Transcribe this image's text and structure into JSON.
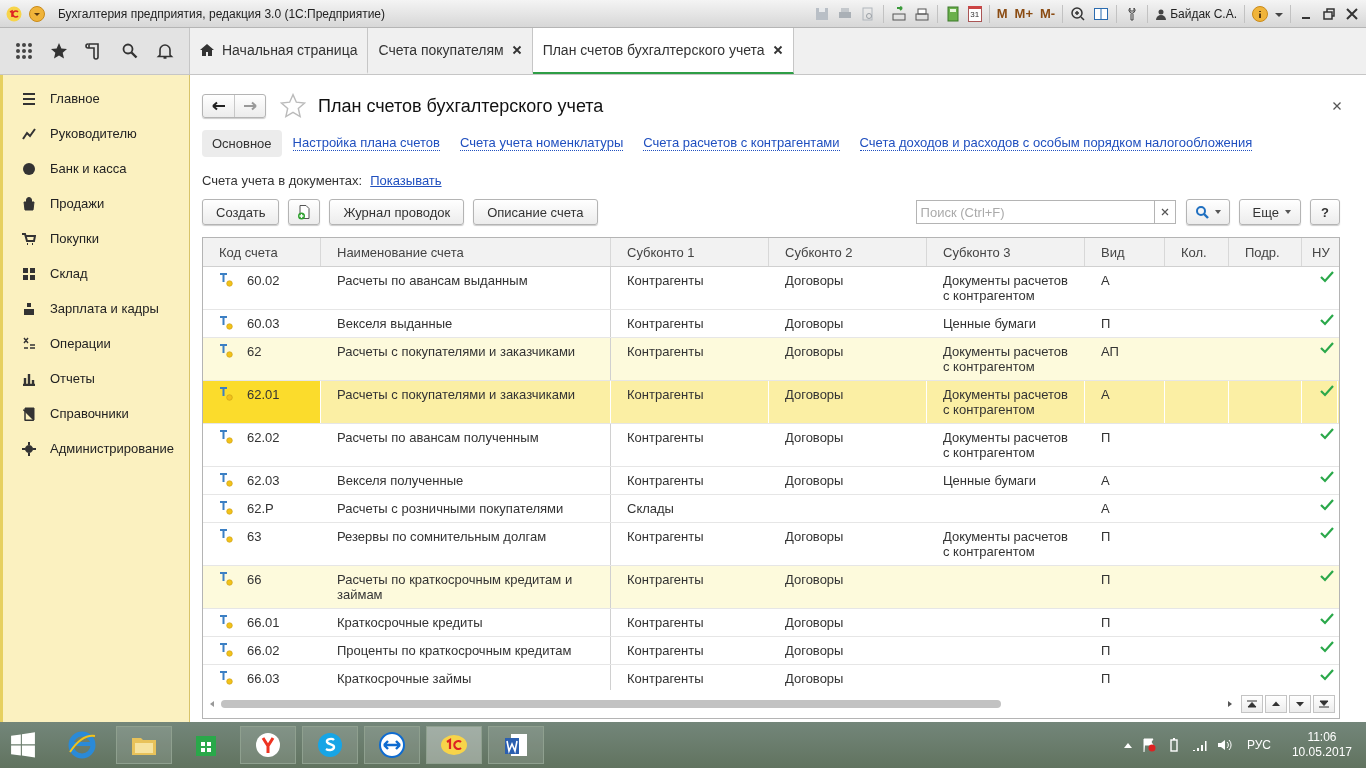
{
  "window": {
    "title": "Бухгалтерия предприятия, редакция 3.0  (1С:Предприятие)",
    "calendar_day": "31",
    "memory_buttons": [
      "M",
      "M+",
      "M-"
    ],
    "user": "Байдак С.А."
  },
  "tabs": [
    {
      "label": "Начальная страница",
      "kind": "home",
      "selected": false
    },
    {
      "label": "Счета покупателям",
      "kind": "closable",
      "selected": false
    },
    {
      "label": "План счетов бухгалтерского учета",
      "kind": "closable",
      "selected": true
    }
  ],
  "sidebar": {
    "items": [
      {
        "label": "Главное"
      },
      {
        "label": "Руководителю"
      },
      {
        "label": "Банк и касса"
      },
      {
        "label": "Продажи"
      },
      {
        "label": "Покупки"
      },
      {
        "label": "Склад"
      },
      {
        "label": "Зарплата и кадры"
      },
      {
        "label": "Операции"
      },
      {
        "label": "Отчеты"
      },
      {
        "label": "Справочники"
      },
      {
        "label": "Администрирование"
      }
    ]
  },
  "page": {
    "title": "План счетов бухгалтерского учета",
    "favorite": false,
    "sections": [
      {
        "label": "Основное",
        "selected": true
      },
      {
        "label": "Настройка плана счетов",
        "selected": false
      },
      {
        "label": "Счета учета номенклатуры",
        "selected": false
      },
      {
        "label": "Счета расчетов с контрагентами",
        "selected": false
      },
      {
        "label": "Счета доходов и расходов с особым порядком налогообложения",
        "selected": false
      }
    ],
    "docs_label": "Счета учета в документах:",
    "docs_link": "Показывать",
    "buttons": [
      "Создать",
      "Журнал проводок",
      "Описание счета"
    ],
    "search": {
      "placeholder": "Поиск (Ctrl+F)"
    },
    "more": "Еще",
    "help": "?"
  },
  "table": {
    "columns": [
      "Код счета",
      "Наименование счета",
      "Субконто 1",
      "Субконто 2",
      "Субконто 3",
      "Вид",
      "Кол.",
      "Подр.",
      "НУ"
    ],
    "rows": [
      {
        "code": "60.02",
        "name": "Расчеты по авансам выданным",
        "sub1": "Контрагенты",
        "sub2": "Договоры",
        "sub3": "Документы расчетов с контрагентом",
        "type": "А",
        "nu": true,
        "group": false,
        "selected": false
      },
      {
        "code": "60.03",
        "name": "Векселя выданные",
        "sub1": "Контрагенты",
        "sub2": "Договоры",
        "sub3": "Ценные бумаги",
        "type": "П",
        "nu": true,
        "group": false,
        "selected": false
      },
      {
        "code": "62",
        "name": "Расчеты с покупателями и заказчиками",
        "sub1": "Контрагенты",
        "sub2": "Договоры",
        "sub3": "Документы расчетов с контрагентом",
        "type": "АП",
        "nu": true,
        "group": true,
        "selected": false
      },
      {
        "code": "62.01",
        "name": "Расчеты с покупателями и заказчиками",
        "sub1": "Контрагенты",
        "sub2": "Договоры",
        "sub3": "Документы расчетов с контрагентом",
        "type": "А",
        "nu": true,
        "group": false,
        "selected": true
      },
      {
        "code": "62.02",
        "name": "Расчеты по авансам полученным",
        "sub1": "Контрагенты",
        "sub2": "Договоры",
        "sub3": "Документы расчетов с контрагентом",
        "type": "П",
        "nu": true,
        "group": false,
        "selected": false
      },
      {
        "code": "62.03",
        "name": "Векселя полученные",
        "sub1": "Контрагенты",
        "sub2": "Договоры",
        "sub3": "Ценные бумаги",
        "type": "А",
        "nu": true,
        "group": false,
        "selected": false
      },
      {
        "code": "62.Р",
        "name": "Расчеты с розничными покупателями",
        "sub1": "Склады",
        "type": "А",
        "nu": true,
        "group": false,
        "selected": false
      },
      {
        "code": "63",
        "name": "Резервы по сомнительным долгам",
        "sub1": "Контрагенты",
        "sub2": "Договоры",
        "sub3": "Документы расчетов с контрагентом",
        "type": "П",
        "nu": true,
        "group": false,
        "selected": false
      },
      {
        "code": "66",
        "name": "Расчеты по краткосрочным кредитам и займам",
        "sub1": "Контрагенты",
        "sub2": "Договоры",
        "type": "П",
        "nu": true,
        "group": true,
        "selected": false
      },
      {
        "code": "66.01",
        "name": "Краткосрочные кредиты",
        "sub1": "Контрагенты",
        "sub2": "Договоры",
        "type": "П",
        "nu": true,
        "group": false,
        "selected": false
      },
      {
        "code": "66.02",
        "name": "Проценты по краткосрочным кредитам",
        "sub1": "Контрагенты",
        "sub2": "Договоры",
        "type": "П",
        "nu": true,
        "group": false,
        "selected": false
      },
      {
        "code": "66.03",
        "name": "Краткосрочные займы",
        "sub1": "Контрагенты",
        "sub2": "Договоры",
        "type": "П",
        "nu": true,
        "group": false,
        "selected": false
      }
    ]
  },
  "taskbar": {
    "language": "РУС",
    "time": "11:06",
    "date": "10.05.2017"
  }
}
